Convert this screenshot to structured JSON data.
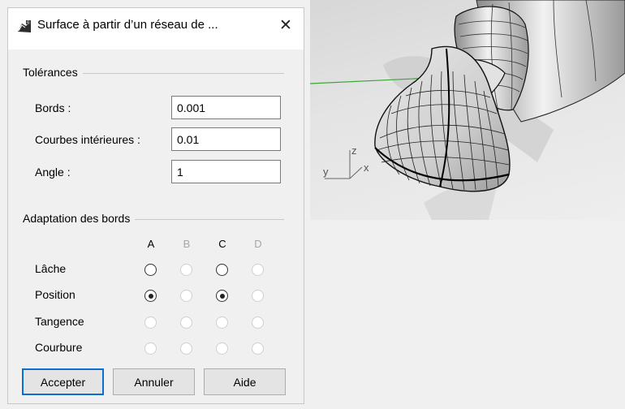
{
  "dialog": {
    "title": "Surface à partir d’un réseau de ...",
    "close_symbol": "✕",
    "icons": {
      "app": "rhino-surface-icon",
      "close": "close-icon"
    }
  },
  "tolerances": {
    "title": "Tolérances",
    "fields": [
      {
        "label": "Bords :",
        "value": "0.001"
      },
      {
        "label": "Courbes intérieures :",
        "value": "0.01"
      },
      {
        "label": "Angle :",
        "value": "1"
      }
    ]
  },
  "edge_matching": {
    "title": "Adaptation des bords",
    "columns": [
      {
        "label": "A",
        "enabled": true
      },
      {
        "label": "B",
        "enabled": false
      },
      {
        "label": "C",
        "enabled": true
      },
      {
        "label": "D",
        "enabled": false
      }
    ],
    "rows": [
      {
        "label": "Lâche",
        "selected": [
          false,
          false,
          false,
          false
        ]
      },
      {
        "label": "Position",
        "selected": [
          true,
          false,
          true,
          false
        ]
      },
      {
        "label": "Tangence",
        "selected": [
          false,
          false,
          false,
          false
        ]
      },
      {
        "label": "Courbure",
        "selected": [
          false,
          false,
          false,
          false
        ]
      }
    ]
  },
  "buttons": {
    "ok": "Accepter",
    "cancel": "Annuler",
    "help": "Aide"
  },
  "viewport": {
    "axis_x": "x",
    "axis_y": "y",
    "axis_z": "z"
  },
  "colors": {
    "accent": "#0a6fd3",
    "axis_green": "#3aa63a",
    "viewport_bg": "#e4e4e4"
  }
}
